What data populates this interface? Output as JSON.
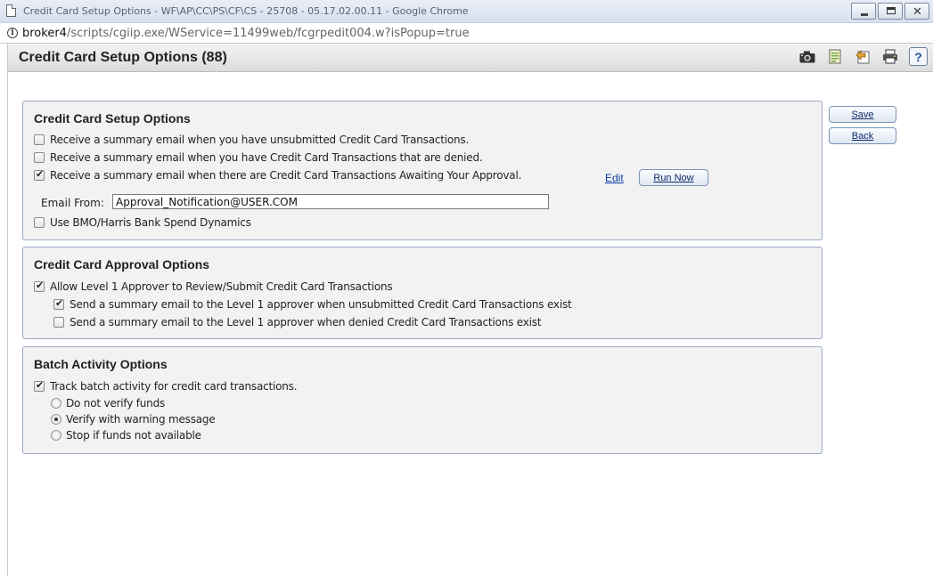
{
  "window": {
    "title": "Credit Card Setup Options - WF\\AP\\CC\\PS\\CF\\CS - 25708 - 05.17.02.00.11 - Google Chrome",
    "controls": [
      "minimize-icon",
      "maximize-icon",
      "close-icon"
    ]
  },
  "address": {
    "host": "broker4",
    "path": "/scripts/cgiip.exe/WService=11499web/fcgrpedit004.w?isPopup=true"
  },
  "header": {
    "title": "Credit Card Setup Options (88)",
    "toolbar_icons": [
      "camera-icon",
      "notes-icon",
      "export-icon",
      "print-icon",
      "help-icon"
    ],
    "help_label": "?"
  },
  "actions": {
    "save_label": "Save",
    "back_label": "Back"
  },
  "setup": {
    "title": "Credit Card Setup Options",
    "options": [
      {
        "label": "Receive a summary email when you have unsubmitted Credit Card Transactions.",
        "checked": false
      },
      {
        "label": "Receive a summary email when you have Credit Card Transactions that are denied.",
        "checked": false
      },
      {
        "label": "Receive a summary email when there are Credit Card Transactions Awaiting Your Approval.",
        "checked": true
      }
    ],
    "edit_label": "Edit",
    "run_now_label": "Run Now",
    "email_from_label": "Email From:",
    "email_from_value": "Approval_Notification@USER.COM",
    "bmo_label": "Use BMO/Harris Bank Spend Dynamics",
    "bmo_checked": false
  },
  "approval": {
    "title": "Credit Card Approval Options",
    "allow_label": "Allow Level 1 Approver to Review/Submit Credit Card Transactions",
    "allow_checked": true,
    "sub_options": [
      {
        "label": "Send a summary email to the Level 1 approver when unsubmitted Credit Card Transactions exist",
        "checked": true
      },
      {
        "label": "Send a summary email to the Level 1 approver when denied Credit Card Transactions exist",
        "checked": false
      }
    ]
  },
  "batch": {
    "title": "Batch Activity Options",
    "track_label": "Track batch activity for credit card transactions.",
    "track_checked": true,
    "radios": [
      {
        "label": "Do not verify funds",
        "checked": false
      },
      {
        "label": "Verify with warning message",
        "checked": true
      },
      {
        "label": "Stop if funds not available",
        "checked": false
      }
    ]
  }
}
